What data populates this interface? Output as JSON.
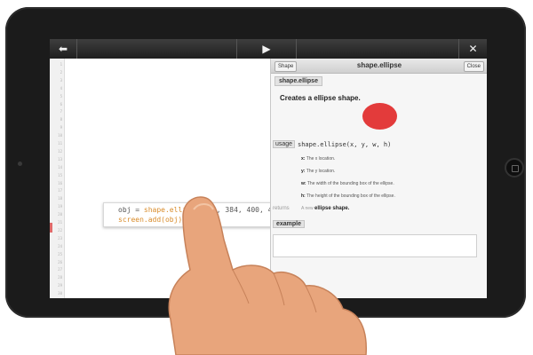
{
  "toolbar": {
    "back_icon": "back-arrow-icon",
    "play_icon": "play-icon",
    "tools_icon": "tools-icon"
  },
  "gutter": {
    "line_numbers": [
      "1",
      "2",
      "3",
      "4",
      "5",
      "6",
      "7",
      "8",
      "9",
      "10",
      "11",
      "12",
      "13",
      "14",
      "15",
      "16",
      "17",
      "18",
      "19",
      "20",
      "21",
      "22",
      "23",
      "24",
      "25",
      "26",
      "27",
      "28",
      "29",
      "30"
    ]
  },
  "code": {
    "line1_prefix": "obj = ",
    "line1_call": "shape.ellipse",
    "line1_args": "(512, 384, 400, 400)",
    "line2": "screen.add(obj)"
  },
  "panel": {
    "shape_button": "Shape",
    "title": "shape.ellipse",
    "close_button": "Close",
    "badge": "shape.ellipse",
    "description": "Creates a ellipse shape.",
    "usage_label": "usage",
    "usage_signature": "shape.ellipse(x, y, w, h)",
    "params": [
      {
        "name": "x:",
        "text": "The x location."
      },
      {
        "name": "y:",
        "text": "The y location."
      },
      {
        "name": "w:",
        "text": "The width of the bounding box of the ellipse."
      },
      {
        "name": "h:",
        "text": "The height of the bounding box of the ellipse."
      }
    ],
    "returns_label": "returns",
    "returns_text": "A new",
    "returns_bold": "ellipse shape.",
    "example_label": "example",
    "circle_color": "#e33b3b"
  }
}
